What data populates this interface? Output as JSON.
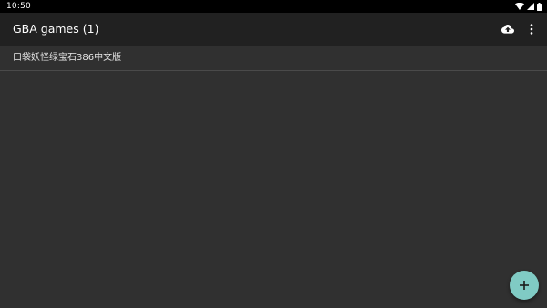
{
  "status_bar": {
    "time": "10:50",
    "icons": [
      "wifi-icon",
      "cellular-signal-icon",
      "battery-icon"
    ]
  },
  "app_bar": {
    "title": "GBA games (1)",
    "actions": [
      "cloud-upload-icon",
      "more-vert-icon"
    ]
  },
  "games": [
    {
      "title": "口袋妖怪绿宝石386中文版"
    }
  ],
  "fab": {
    "icon": "add-icon"
  },
  "colors": {
    "status_bar_bg": "#000000",
    "app_bar_bg": "#212121",
    "background": "#303030",
    "divider": "#4a4a4a",
    "fab_bg": "#80cbc4",
    "text_primary": "#ffffff"
  }
}
